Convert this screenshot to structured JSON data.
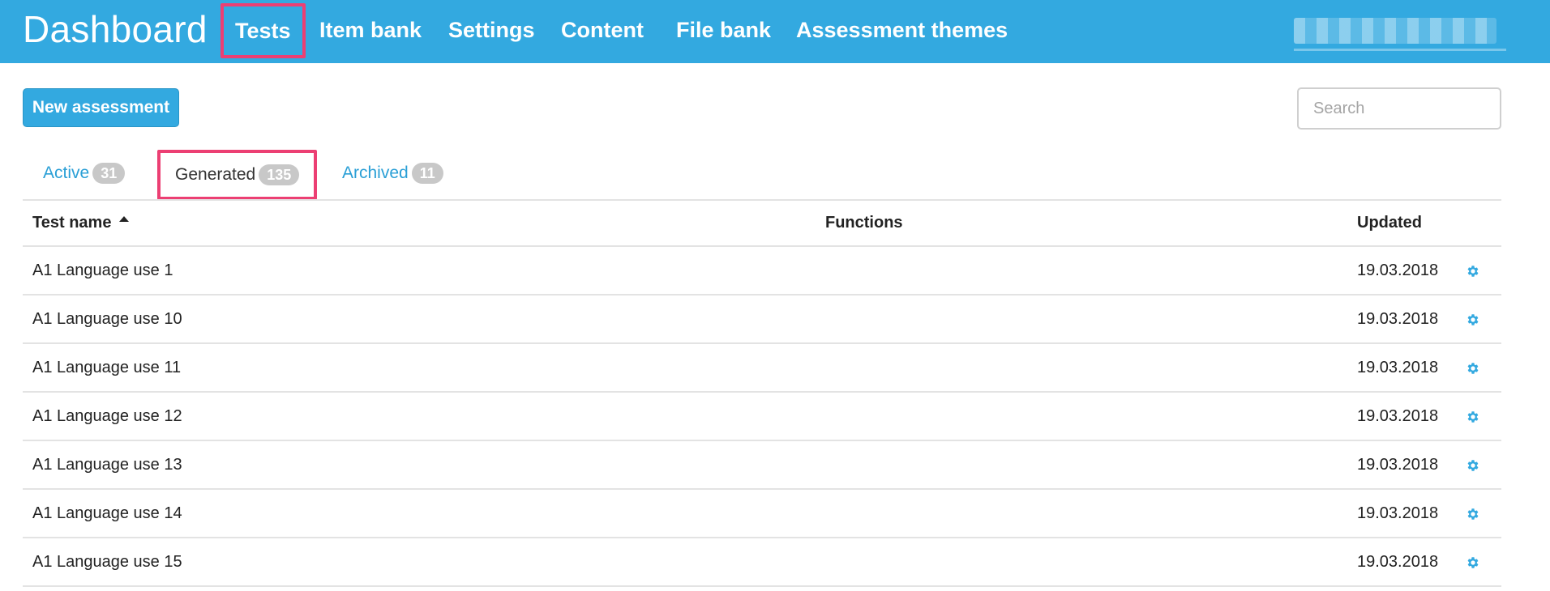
{
  "header": {
    "brand": "Dashboard",
    "nav": [
      {
        "label": "Tests",
        "active": true
      },
      {
        "label": "Item bank",
        "active": false
      },
      {
        "label": "Settings",
        "active": false
      },
      {
        "label": "Content",
        "active": false
      },
      {
        "label": "File bank",
        "active": false
      },
      {
        "label": "Assessment themes",
        "active": false
      }
    ]
  },
  "toolbar": {
    "new_label": "New assessment",
    "search_placeholder": "Search"
  },
  "tabs": [
    {
      "label": "Active",
      "count": "31",
      "active": false
    },
    {
      "label": "Generated",
      "count": "135",
      "active": true
    },
    {
      "label": "Archived",
      "count": "11",
      "active": false
    }
  ],
  "table": {
    "columns": {
      "name": "Test name",
      "functions": "Functions",
      "updated": "Updated"
    },
    "rows": [
      {
        "name": "A1 Language use 1",
        "updated": "19.03.2018"
      },
      {
        "name": "A1 Language use 10",
        "updated": "19.03.2018"
      },
      {
        "name": "A1 Language use 11",
        "updated": "19.03.2018"
      },
      {
        "name": "A1 Language use 12",
        "updated": "19.03.2018"
      },
      {
        "name": "A1 Language use 13",
        "updated": "19.03.2018"
      },
      {
        "name": "A1 Language use 14",
        "updated": "19.03.2018"
      },
      {
        "name": "A1 Language use 15",
        "updated": "19.03.2018"
      }
    ]
  },
  "icons": {
    "row_action": "gear-icon",
    "sort": "sort-ascending-icon"
  },
  "colors": {
    "primary": "#33a9e0",
    "highlight": "#ec3f73",
    "badge": "#c8c8c8",
    "link": "#2a9fd6"
  }
}
